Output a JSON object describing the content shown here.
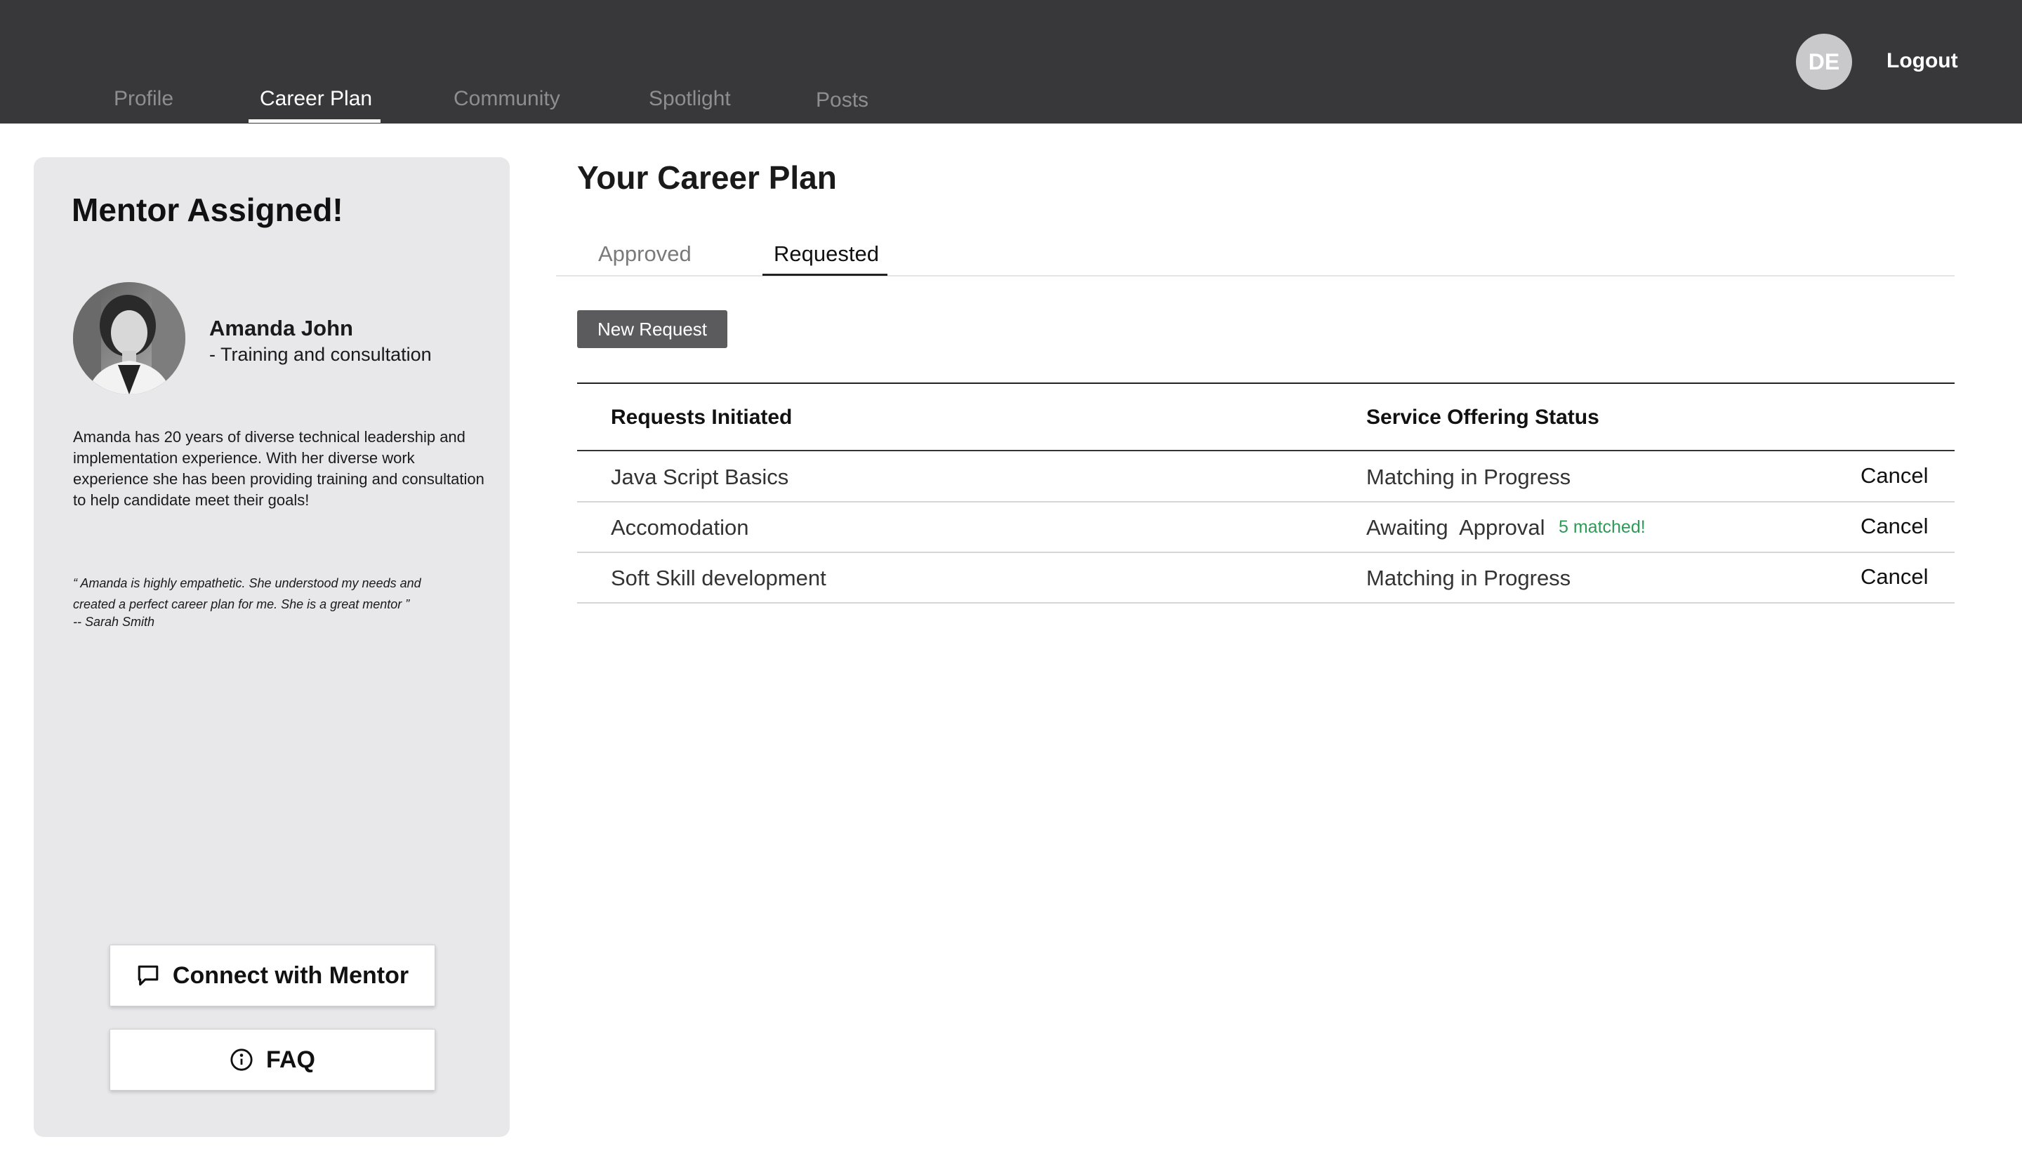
{
  "header": {
    "nav": [
      {
        "label": "Profile"
      },
      {
        "label": "Career Plan"
      },
      {
        "label": "Community"
      },
      {
        "label": "Spotlight"
      },
      {
        "label": "Posts"
      }
    ],
    "active_nav": "Career Plan",
    "avatar_initials": "DE",
    "logout_label": "Logout"
  },
  "sidebar": {
    "title": "Mentor Assigned!",
    "mentor_name": "Amanda John",
    "mentor_role": "- Training and consultation",
    "bio": "Amanda has 20 years of diverse technical leadership and implementation experience. With her diverse work experience she has been providing training and consultation to help candidate meet their goals!",
    "testimonial": "“ Amanda is highly empathetic. She understood my needs and created a perfect career plan for me. She is a great mentor ”",
    "testimonial_author": "-- Sarah Smith",
    "connect_label": "Connect with Mentor",
    "faq_label": "FAQ"
  },
  "main": {
    "title": "Your Career Plan",
    "tabs": [
      {
        "label": "Approved"
      },
      {
        "label": "Requested"
      }
    ],
    "active_tab": "Requested",
    "new_request_label": "New Request",
    "table": {
      "columns": [
        "Requests Initiated",
        "Service Offering Status"
      ],
      "rows": [
        {
          "request": "Java Script Basics",
          "status": "Matching in Progress",
          "badge": "",
          "action": "Cancel"
        },
        {
          "request": "Accomodation",
          "status": "Awaiting  Approval",
          "badge": "5 matched!",
          "action": "Cancel"
        },
        {
          "request": "Soft Skill development",
          "status": "Matching in Progress",
          "badge": "",
          "action": "Cancel"
        }
      ]
    }
  },
  "colors": {
    "header_bg": "#38383a",
    "panel_bg": "#e8e8ea",
    "matched_green": "#2e9a57",
    "button_dark": "#5b5b5d"
  },
  "icons": {
    "connect": "chat-bubble-icon",
    "faq": "info-circle-icon"
  }
}
